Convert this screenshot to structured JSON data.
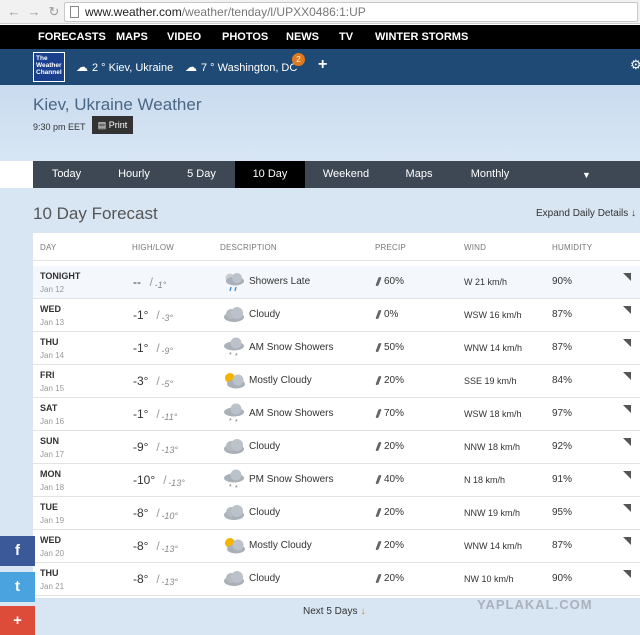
{
  "browser": {
    "url_host": "www.weather.com",
    "url_path": "/weather/tenday/l/UPXX0486:1:UP"
  },
  "topnav": [
    "FORECASTS",
    "MAPS",
    "VIDEO",
    "PHOTOS",
    "NEWS",
    "TV",
    "WINTER STORMS"
  ],
  "logo": "The Weather Channel",
  "locations": [
    {
      "temp": "2 °",
      "name": "Kiev, Ukraine"
    },
    {
      "temp": "7 °",
      "name": "Washington, DC"
    }
  ],
  "notification_count": "2",
  "header": {
    "title": "Kiev, Ukraine Weather",
    "time": "9:30 pm EET",
    "print_label": "Print"
  },
  "tabs": [
    "Today",
    "Hourly",
    "5 Day",
    "10 Day",
    "Weekend",
    "Maps",
    "Monthly"
  ],
  "active_tab": "10 Day",
  "forecast": {
    "title": "10 Day Forecast",
    "expand_label": "Expand Daily Details",
    "columns": [
      "DAY",
      "HIGH/LOW",
      "DESCRIPTION",
      "PRECIP",
      "WIND",
      "HUMIDITY"
    ],
    "rows": [
      {
        "day": "TONIGHT",
        "date": "Jan 12",
        "high": "--",
        "low": "-1°",
        "icon": "showers-icon",
        "desc": "Showers Late",
        "precip": "60%",
        "wind": "W 21 km/h",
        "humidity": "90%"
      },
      {
        "day": "WED",
        "date": "Jan 13",
        "high": "-1°",
        "low": "-3°",
        "icon": "cloudy-icon",
        "desc": "Cloudy",
        "precip": "0%",
        "wind": "WSW 16 km/h",
        "humidity": "87%"
      },
      {
        "day": "THU",
        "date": "Jan 14",
        "high": "-1°",
        "low": "-9°",
        "icon": "snow-showers-icon",
        "desc": "AM Snow Showers",
        "precip": "50%",
        "wind": "WNW 14 km/h",
        "humidity": "87%"
      },
      {
        "day": "FRI",
        "date": "Jan 15",
        "high": "-3°",
        "low": "-5°",
        "icon": "mostly-cloudy-icon",
        "desc": "Mostly Cloudy",
        "precip": "20%",
        "wind": "SSE 19 km/h",
        "humidity": "84%"
      },
      {
        "day": "SAT",
        "date": "Jan 16",
        "high": "-1°",
        "low": "-11°",
        "icon": "snow-showers-icon",
        "desc": "AM Snow Showers",
        "precip": "70%",
        "wind": "WSW 18 km/h",
        "humidity": "97%"
      },
      {
        "day": "SUN",
        "date": "Jan 17",
        "high": "-9°",
        "low": "-13°",
        "icon": "cloudy-icon",
        "desc": "Cloudy",
        "precip": "20%",
        "wind": "NNW 18 km/h",
        "humidity": "92%"
      },
      {
        "day": "MON",
        "date": "Jan 18",
        "high": "-10°",
        "low": "-13°",
        "icon": "snow-showers-icon",
        "desc": "PM Snow Showers",
        "precip": "40%",
        "wind": "N 18 km/h",
        "humidity": "91%"
      },
      {
        "day": "TUE",
        "date": "Jan 19",
        "high": "-8°",
        "low": "-10°",
        "icon": "cloudy-icon",
        "desc": "Cloudy",
        "precip": "20%",
        "wind": "NNW 19 km/h",
        "humidity": "95%"
      },
      {
        "day": "WED",
        "date": "Jan 20",
        "high": "-8°",
        "low": "-13°",
        "icon": "mostly-cloudy-icon",
        "desc": "Mostly Cloudy",
        "precip": "20%",
        "wind": "WNW 14 km/h",
        "humidity": "87%"
      },
      {
        "day": "THU",
        "date": "Jan 21",
        "high": "-8°",
        "low": "-13°",
        "icon": "cloudy-icon",
        "desc": "Cloudy",
        "precip": "20%",
        "wind": "NW 10 km/h",
        "humidity": "90%"
      }
    ],
    "next_label": "Next 5 Days"
  },
  "watermark": "YAPLAKAL.COM",
  "social": [
    "facebook-icon",
    "twitter-icon",
    "google-plus-icon"
  ]
}
